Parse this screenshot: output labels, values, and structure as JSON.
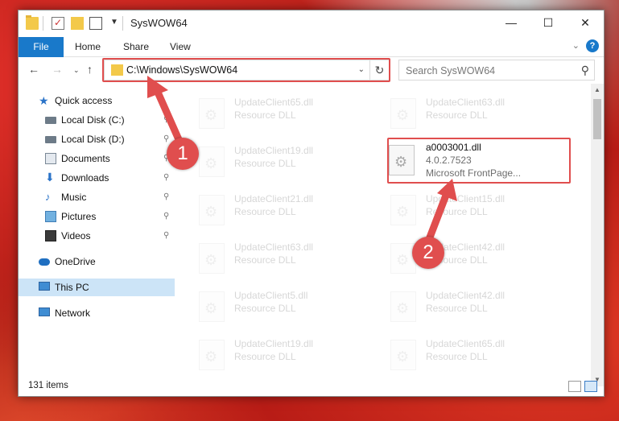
{
  "window": {
    "title": "SysWOW64",
    "min_glyph": "—",
    "max_glyph": "☐",
    "close_glyph": "✕"
  },
  "ribbon": {
    "file_tab": "File",
    "tabs": [
      "Home",
      "Share",
      "View"
    ],
    "help_glyph": "?"
  },
  "navigation": {
    "back": "←",
    "forward": "→",
    "recent": "⌄",
    "up": "↑",
    "address": "C:\\Windows\\SysWOW64",
    "refresh": "↻",
    "search_placeholder": "Search SysWOW64",
    "search_glyph": "⚲"
  },
  "sidebar": {
    "items": [
      {
        "label": "Quick access",
        "icon": "star-icon",
        "pinned": false
      },
      {
        "label": "Local Disk (C:)",
        "icon": "drive-icon",
        "pinned": true
      },
      {
        "label": "Local Disk (D:)",
        "icon": "drive-icon",
        "pinned": true
      },
      {
        "label": "Documents",
        "icon": "documents-icon",
        "pinned": true
      },
      {
        "label": "Downloads",
        "icon": "downloads-icon",
        "pinned": true
      },
      {
        "label": "Music",
        "icon": "music-icon",
        "pinned": true
      },
      {
        "label": "Pictures",
        "icon": "pictures-icon",
        "pinned": true
      },
      {
        "label": "Videos",
        "icon": "videos-icon",
        "pinned": true
      },
      {
        "label": "OneDrive",
        "icon": "onedrive-icon",
        "pinned": false
      },
      {
        "label": "This PC",
        "icon": "computer-icon",
        "pinned": false,
        "selected": true
      },
      {
        "label": "Network",
        "icon": "network-icon",
        "pinned": false
      }
    ],
    "pin_glyph": "📌"
  },
  "files": {
    "left_column": [
      {
        "name": "UpdateClient65.dll",
        "type": "Resource DLL"
      },
      {
        "name": "UpdateClient19.dll",
        "type": "Resource DLL"
      },
      {
        "name": "UpdateClient21.dll",
        "type": "Resource DLL"
      },
      {
        "name": "UpdateClient63.dll",
        "type": "Resource DLL"
      },
      {
        "name": "UpdateClient5.dll",
        "type": "Resource DLL"
      },
      {
        "name": "UpdateClient19.dll",
        "type": "Resource DLL"
      }
    ],
    "right_column": [
      {
        "name": "UpdateClient63.dll",
        "type": "Resource DLL"
      },
      {
        "name": "a0003001.dll",
        "version": "4.0.2.7523",
        "description": "Microsoft FrontPage...",
        "highlighted": true
      },
      {
        "name": "UpdateClient15.dll",
        "type": "Resource DLL"
      },
      {
        "name": "UpdateClient42.dll",
        "type": "Resource DLL"
      },
      {
        "name": "UpdateClient42.dll",
        "type": "Resource DLL"
      },
      {
        "name": "UpdateClient65.dll",
        "type": "Resource DLL"
      }
    ]
  },
  "status": {
    "item_count": "131 items"
  },
  "callouts": {
    "one": "1",
    "two": "2",
    "color": "#e04e4e"
  },
  "colors": {
    "accent": "#1979ca",
    "selection": "#cce4f7",
    "highlight": "#e04e4e"
  }
}
